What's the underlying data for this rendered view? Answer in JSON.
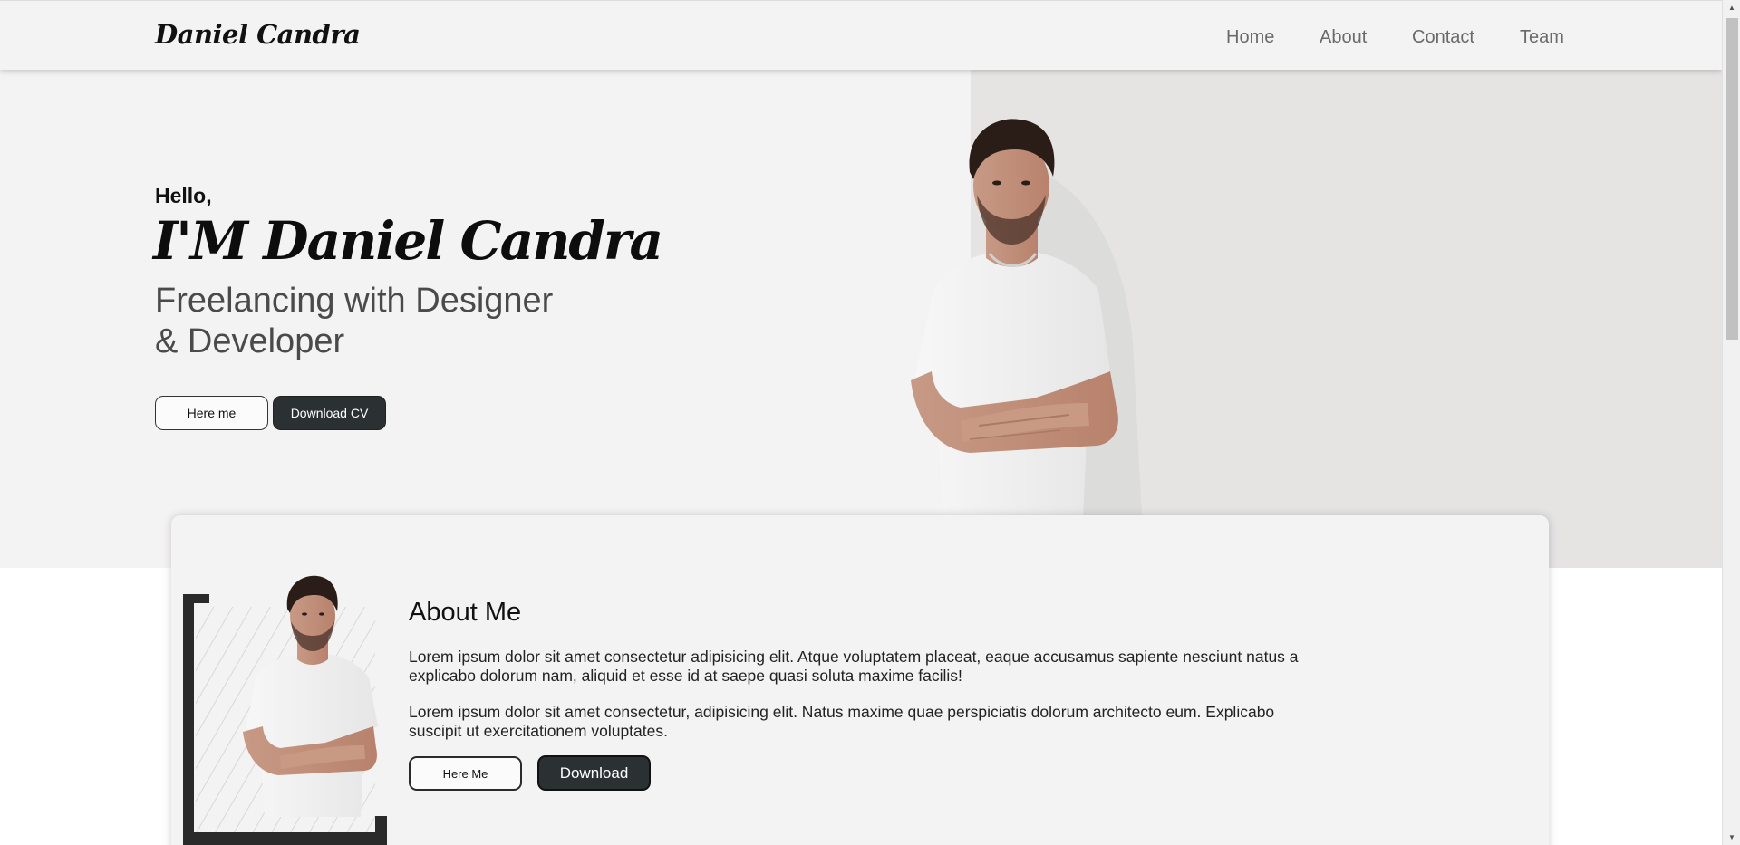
{
  "header": {
    "brand": "Daniel Candra",
    "nav": [
      "Home",
      "About",
      "Contact",
      "Team"
    ]
  },
  "hero": {
    "greeting": "Hello,",
    "name": "I'M Daniel Candra",
    "subtitle_line1": "Freelancing with Designer",
    "subtitle_line2": "& Developer",
    "btn_hire": "Here me",
    "btn_cv": "Download CV"
  },
  "about": {
    "title": "About Me",
    "paragraph1": "Lorem ipsum dolor sit amet consectetur adipisicing elit. Atque voluptatem placeat, eaque accusamus sapiente nesciunt natus a explicabo dolorum nam, aliquid et esse id at saepe quasi soluta maxime facilis!",
    "paragraph2": "Lorem ipsum dolor sit amet consectetur, adipisicing elit. Natus maxime quae perspiciatis dolorum architecto eum. Explicabo suscipit ut exercitationem voluptates.",
    "btn_hire": "Here Me",
    "btn_download": "Download"
  },
  "colors": {
    "hero_bg": "#f4f3f3",
    "hero_photo_bg": "#e5e4e3",
    "dark_button": "#2b3133",
    "nav_text": "#6a6a6a"
  },
  "icons": {
    "scroll_up": "scroll-up-arrow-icon",
    "scroll_down": "scroll-down-arrow-icon"
  }
}
